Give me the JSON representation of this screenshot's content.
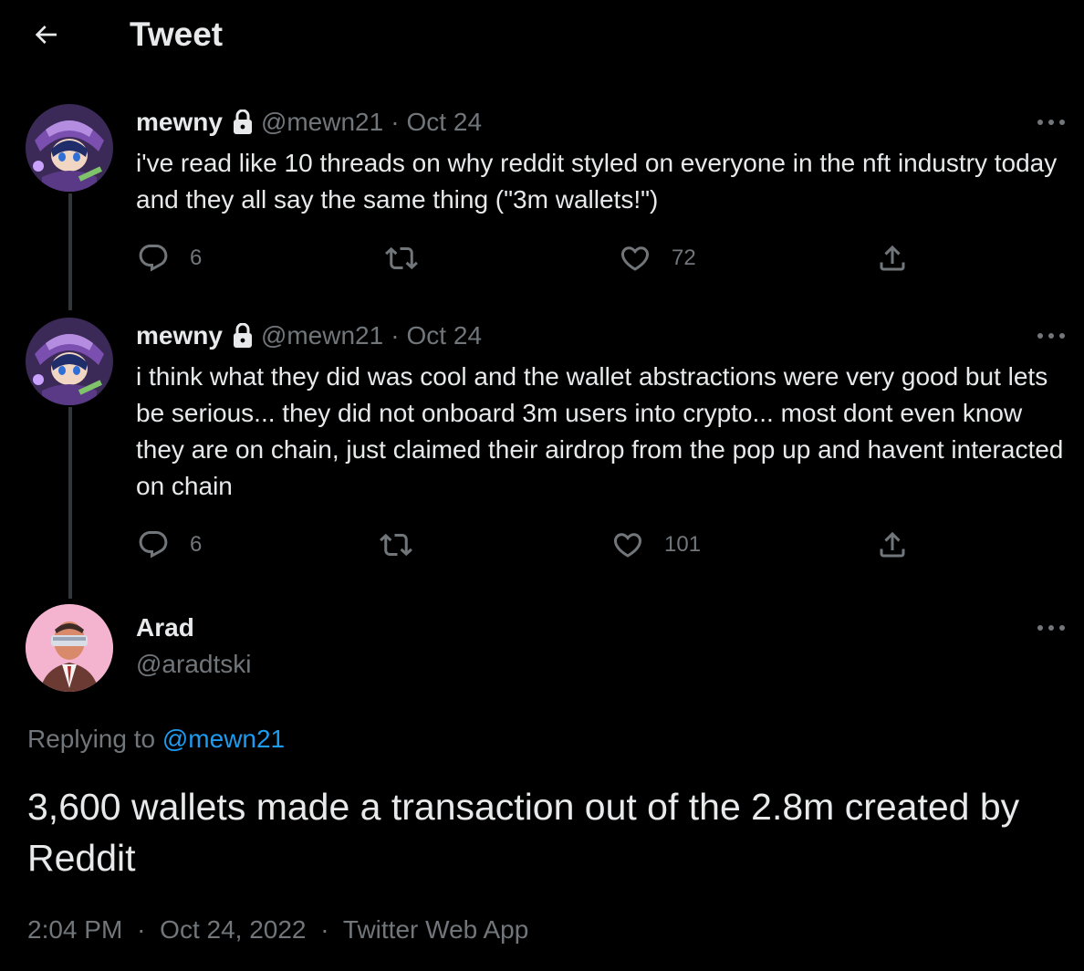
{
  "header": {
    "title": "Tweet",
    "back_icon": "arrow-left-icon"
  },
  "thread": [
    {
      "name": "mewny",
      "handle": "@mewn21",
      "separator": "·",
      "date": "Oct 24",
      "text": "i've read like 10 threads on why reddit styled on everyone in the nft industry today and they all say the same thing (\"3m wallets!\")",
      "replies": "6",
      "retweets": "",
      "likes": "72"
    },
    {
      "name": "mewny",
      "handle": "@mewn21",
      "separator": "·",
      "date": "Oct 24",
      "text": "i think what they did was cool and the wallet abstractions were very good but lets be serious... they did not onboard 3m users into crypto... most dont even know they are on chain, just claimed their airdrop from the pop up and havent interacted on chain",
      "replies": "6",
      "retweets": "",
      "likes": "101"
    }
  ],
  "main_tweet": {
    "name": "Arad",
    "handle": "@aradtski",
    "replying_prefix": "Replying to",
    "replying_to": "@mewn21",
    "text": "3,600 wallets made a transaction out of the 2.8m created by Reddit",
    "time": "2:04 PM",
    "date": "Oct 24, 2022",
    "source": "Twitter Web App",
    "separator": "·"
  },
  "colors": {
    "background": "#000000",
    "text": "#e7e9ea",
    "muted": "#71767b",
    "accent": "#1d9bf0",
    "thread_line": "#333639"
  }
}
